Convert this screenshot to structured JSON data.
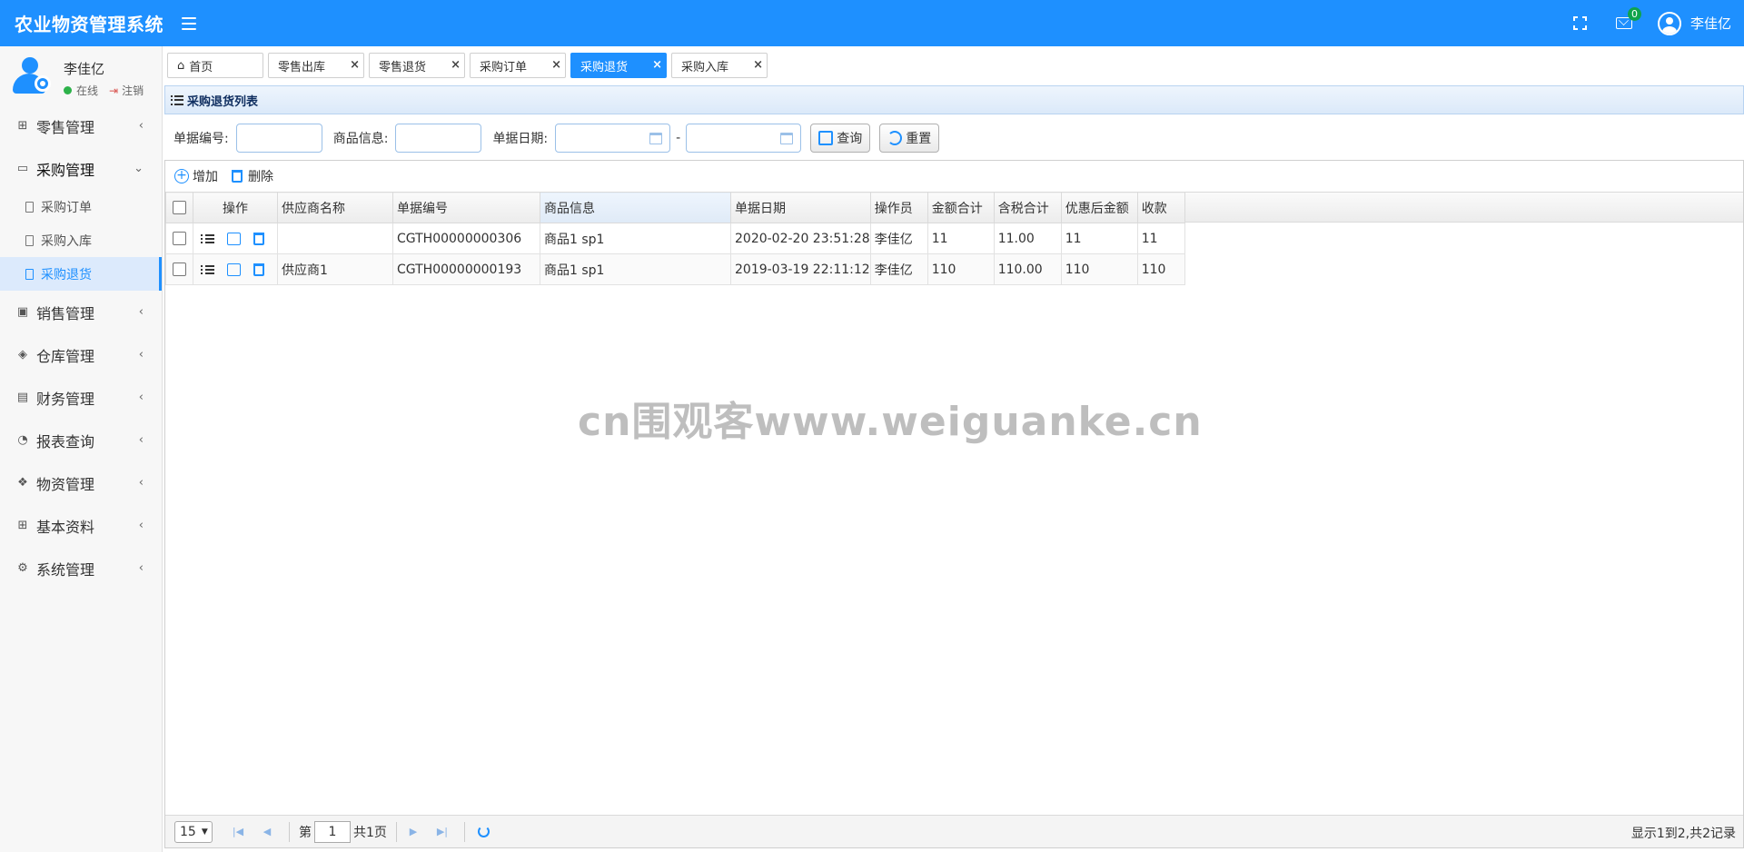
{
  "app": {
    "title": "农业物资管理系统"
  },
  "topbar": {
    "mail_count": "0",
    "user_name": "李佳亿"
  },
  "sidebar": {
    "user_name": "李佳亿",
    "status_label": "在线",
    "logout_label": "注销",
    "menu": [
      {
        "label": "零售管理",
        "icon": "gift-icon"
      },
      {
        "label": "采购管理",
        "icon": "monitor-icon",
        "open": true,
        "children": [
          {
            "label": "采购订单"
          },
          {
            "label": "采购入库"
          },
          {
            "label": "采购退货",
            "active": true
          }
        ]
      },
      {
        "label": "销售管理",
        "icon": "briefcase-icon"
      },
      {
        "label": "仓库管理",
        "icon": "layers-icon"
      },
      {
        "label": "财务管理",
        "icon": "book-icon"
      },
      {
        "label": "报表查询",
        "icon": "pie-chart-icon"
      },
      {
        "label": "物资管理",
        "icon": "dropbox-icon"
      },
      {
        "label": "基本资料",
        "icon": "grid-icon"
      },
      {
        "label": "系统管理",
        "icon": "gear-icon"
      }
    ]
  },
  "tabs": [
    {
      "label": "首页",
      "closable": false
    },
    {
      "label": "零售出库",
      "closable": true
    },
    {
      "label": "零售退货",
      "closable": true
    },
    {
      "label": "采购订单",
      "closable": true
    },
    {
      "label": "采购退货",
      "closable": true,
      "active": true
    },
    {
      "label": "采购入库",
      "closable": true
    }
  ],
  "panel": {
    "title": "采购退货列表"
  },
  "search": {
    "bill_no_label": "单据编号:",
    "goods_label": "商品信息:",
    "date_label": "单据日期:",
    "date_sep": "-",
    "query_button": "查询",
    "reset_button": "重置"
  },
  "toolbar": {
    "add_label": "增加",
    "delete_label": "删除"
  },
  "table": {
    "columns": [
      "操作",
      "供应商名称",
      "单据编号",
      "商品信息",
      "单据日期",
      "操作员",
      "金额合计",
      "含税合计",
      "优惠后金额",
      "收款"
    ],
    "rows": [
      [
        "",
        "CGTH00000000306",
        "商品1 sp1",
        "2020-02-20 23:51:28",
        "李佳亿",
        "11",
        "11.00",
        "11",
        "11"
      ],
      [
        "供应商1",
        "CGTH00000000193",
        "商品1 sp1",
        "2019-03-19 22:11:12",
        "李佳亿",
        "110",
        "110.00",
        "110",
        "110"
      ]
    ]
  },
  "pager": {
    "page_size": "15",
    "page_prefix": "第",
    "current_page": "1",
    "page_suffix": "共1页",
    "info": "显示1到2,共2记录"
  },
  "watermark": "cn围观客www.weiguanke.cn",
  "colors": {
    "accent": "#1e90ff",
    "online": "#2db24a",
    "badge": "#0fa34c"
  }
}
